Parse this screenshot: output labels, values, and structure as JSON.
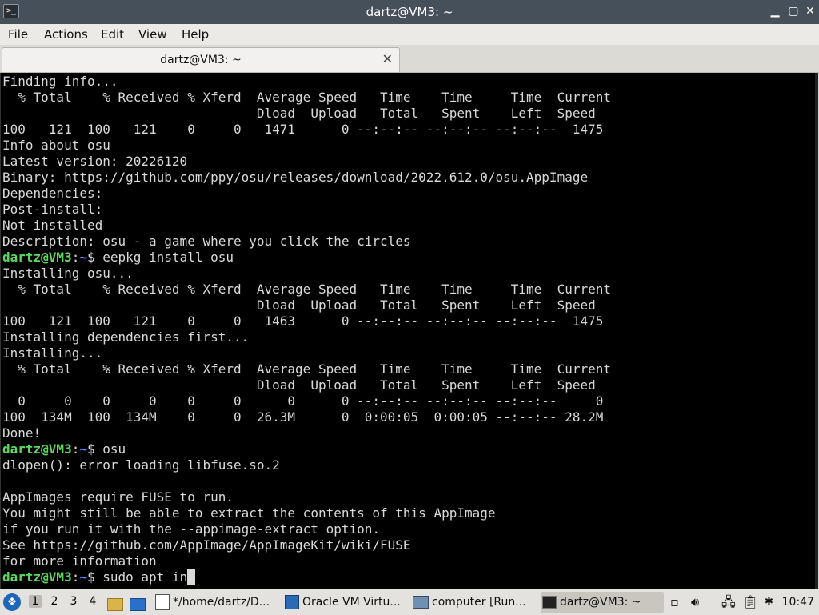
{
  "window": {
    "title": "dartz@VM3: ~",
    "icon": "terminal-icon",
    "minimize_glyph": "▁",
    "maximize_glyph": "▢",
    "close_glyph": "✕"
  },
  "menu": {
    "file": "File",
    "actions": "Actions",
    "edit": "Edit",
    "view": "View",
    "help": "Help"
  },
  "tab": {
    "label": "dartz@VM3: ~",
    "close_glyph": "✕"
  },
  "terminal": {
    "lines": [
      "Finding info...",
      "  % Total    % Received % Xferd  Average Speed   Time    Time     Time  Current",
      "                                 Dload  Upload   Total   Spent    Left  Speed",
      "100   121  100   121    0     0   1471      0 --:--:-- --:--:-- --:--:--  1475",
      "Info about osu",
      "Latest version: 20226120",
      "Binary: https://github.com/ppy/osu/releases/download/2022.612.0/osu.AppImage",
      "Dependencies:",
      "Post-install:",
      "Not installed",
      "Description: osu - a game where you click the circles",
      {
        "prompt_user": "dartz@VM3",
        "prompt_path": "~",
        "cmd": "eepkg install osu"
      },
      "Installing osu...",
      "  % Total    % Received % Xferd  Average Speed   Time    Time     Time  Current",
      "                                 Dload  Upload   Total   Spent    Left  Speed",
      "100   121  100   121    0     0   1463      0 --:--:-- --:--:-- --:--:--  1475",
      "Installing dependencies first...",
      "Installing...",
      "  % Total    % Received % Xferd  Average Speed   Time    Time     Time  Current",
      "                                 Dload  Upload   Total   Spent    Left  Speed",
      "  0     0    0     0    0     0      0      0 --:--:-- --:--:-- --:--:--     0",
      "100  134M  100  134M    0     0  26.3M      0  0:00:05  0:00:05 --:--:-- 28.2M",
      "Done!",
      {
        "prompt_user": "dartz@VM3",
        "prompt_path": "~",
        "cmd": "osu"
      },
      "dlopen(): error loading libfuse.so.2",
      "",
      "AppImages require FUSE to run.",
      "You might still be able to extract the contents of this AppImage",
      "if you run it with the --appimage-extract option.",
      "See https://github.com/AppImage/AppImageKit/wiki/FUSE",
      "for more information",
      {
        "prompt_user": "dartz@VM3",
        "prompt_path": "~",
        "cmd": "sudo apt in",
        "cursor": true
      }
    ]
  },
  "taskbar": {
    "start_icon": "start-menu-icon",
    "workspaces": [
      "1",
      "2",
      "3",
      "4"
    ],
    "active_workspace": "1",
    "buttons": [
      {
        "name": "taskbar-file-manager",
        "icon": "text-editor-icon",
        "label": "*/home/dartz/D..."
      },
      {
        "name": "taskbar-virtualbox",
        "icon": "virtualbox-icon",
        "label": "Oracle VM Virtu..."
      },
      {
        "name": "taskbar-computer",
        "icon": "computer-icon",
        "label": "computer [Run..."
      },
      {
        "name": "taskbar-terminal",
        "icon": "terminal-icon",
        "label": "dartz@VM3: ~"
      }
    ],
    "clock": "10:47"
  },
  "colors": {
    "terminal_bg": "#000000",
    "terminal_fg": "#d8d8d8",
    "prompt_user": "#5fd75f",
    "prompt_path": "#5f87ff",
    "titlebar_bg": "#46505a"
  }
}
